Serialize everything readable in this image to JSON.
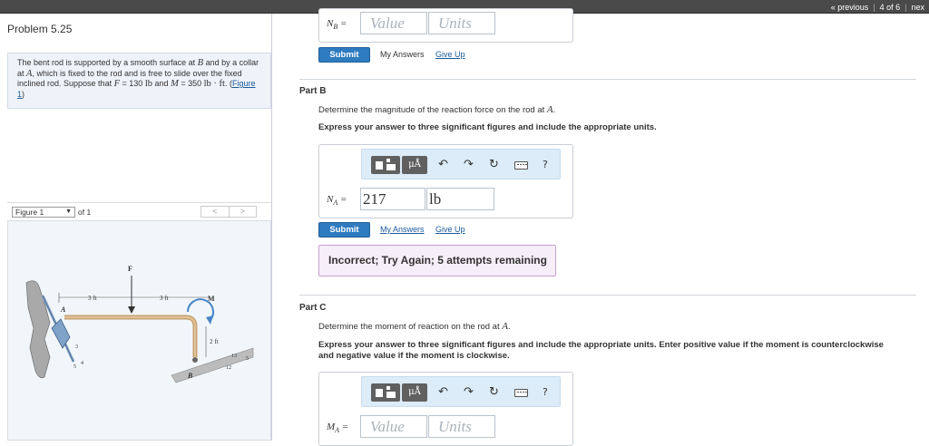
{
  "topnav": {
    "previous": "« previous",
    "position": "4 of 6",
    "next": "nex"
  },
  "problem": {
    "title": "Problem 5.25",
    "text_1": "The bent rod is supported by a smooth surface at",
    "B": "B",
    "text_2": "and by a collar at",
    "A": "A",
    "text_3": ", which is fixed to the rod and is free to slide over the fixed inclined rod. Suppose that",
    "F": "F",
    "F_value": "= 130",
    "F_unit": "lb",
    "text_4": "and",
    "M": "M",
    "M_value": "= 350",
    "M_unit": "lb · ft",
    "text_5": ". (",
    "figure_link": "Figure 1",
    "text_6": ")"
  },
  "figure_nav": {
    "select_value": "Figure 1",
    "of_text": "of 1",
    "prev": "<",
    "next": ">"
  },
  "figure": {
    "F": "F",
    "M": "M",
    "A": "A",
    "B": "B",
    "dim_left": "3 ft",
    "dim_right": "3 ft",
    "dim_vert": "2 ft",
    "slope_A_3": "3",
    "slope_A_4": "4",
    "slope_A_5": "5",
    "slope_B_13": "13",
    "slope_B_5": "5",
    "slope_B_12": "12"
  },
  "part_a_tail": {
    "label_main": "N",
    "label_sub": "B",
    "label_eq": "=",
    "value_placeholder": "Value",
    "units_placeholder": "Units",
    "submit": "Submit",
    "my_answers": "My Answers",
    "give_up": "Give Up"
  },
  "part_b": {
    "title": "Part B",
    "question_pre": "Determine the magnitude of the reaction force on the rod at",
    "question_var": "A",
    "question_post": ".",
    "instruction": "Express your answer to three significant figures and include the appropriate units.",
    "label_main": "N",
    "label_sub": "A",
    "label_eq": "=",
    "value": "217",
    "units": "lb",
    "submit": "Submit",
    "my_answers": "My Answers",
    "give_up": "Give Up",
    "feedback": "Incorrect; Try Again; 5 attempts remaining"
  },
  "part_c": {
    "title": "Part C",
    "question_pre": "Determine the moment of reaction on the rod at",
    "question_var": "A",
    "question_post": ".",
    "instruction_line1": "Express your answer to three significant figures and include the appropriate units. Enter positive value if the moment is counterclockwise",
    "instruction_line2": "and negative value if the moment is clockwise.",
    "label_main": "M",
    "label_sub": "A",
    "label_eq": "=",
    "value_placeholder": "Value",
    "units_placeholder": "Units"
  },
  "toolbar": {
    "units_glyph": "μÅ",
    "undo": "↶",
    "redo": "↷",
    "reset": "↻",
    "help": "?",
    "icons": [
      "templates-icon",
      "units-icon",
      "undo-icon",
      "redo-icon",
      "reset-icon",
      "keyboard-icon",
      "help-icon"
    ]
  }
}
